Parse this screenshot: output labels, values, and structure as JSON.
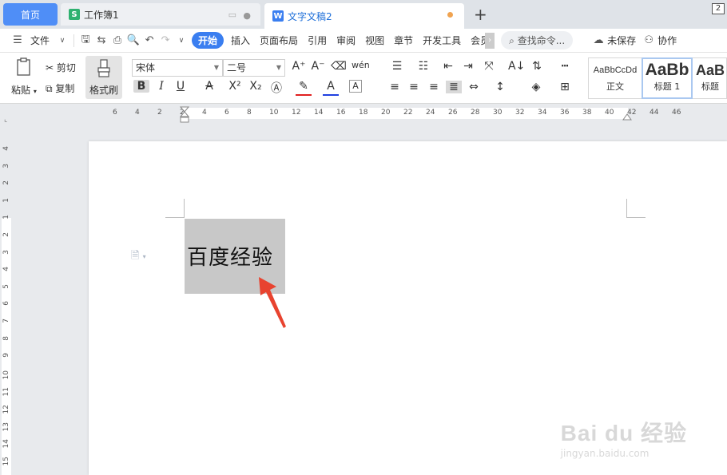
{
  "tabs": {
    "home": "首页",
    "workbook": "工作簿1",
    "doc": "文字文稿2",
    "window_count": "2"
  },
  "menu": {
    "file": "文件",
    "items": [
      "开始",
      "插入",
      "页面布局",
      "引用",
      "审阅",
      "视图",
      "章节",
      "开发工具",
      "会员"
    ],
    "search": "查找命令...",
    "unsaved": "未保存",
    "collab": "协作"
  },
  "ribbon": {
    "paste": "粘贴",
    "cut": "剪切",
    "copy": "复制",
    "format_painter": "格式刷",
    "font_name": "宋体",
    "font_size": "二号"
  },
  "styles": [
    {
      "sample": "AaBbCcDd",
      "name": "正文"
    },
    {
      "sample": "AaBb",
      "name": "标题 1"
    },
    {
      "sample": "AaB",
      "name": "标题"
    }
  ],
  "hruler": {
    "labels": [
      "6",
      "4",
      "2",
      "2",
      "4",
      "6",
      "8",
      "10",
      "12",
      "14",
      "16",
      "18",
      "20",
      "22",
      "24",
      "26",
      "28",
      "30",
      "32",
      "34",
      "36",
      "38",
      "40",
      "42",
      "44",
      "46"
    ]
  },
  "vruler": {
    "labels": [
      "4",
      "3",
      "2",
      "1",
      "1",
      "2",
      "3",
      "4",
      "5",
      "6",
      "7",
      "8",
      "9",
      "10",
      "11",
      "12",
      "13",
      "14",
      "15"
    ]
  },
  "document": {
    "text": "百度经验"
  },
  "watermark": {
    "brand": "Bai du 经验",
    "url": "jingyan.baidu.com"
  },
  "colors": {
    "accent": "#3a7ef0",
    "home_tab": "#4f8ef7",
    "arrow": "#e8432f"
  }
}
